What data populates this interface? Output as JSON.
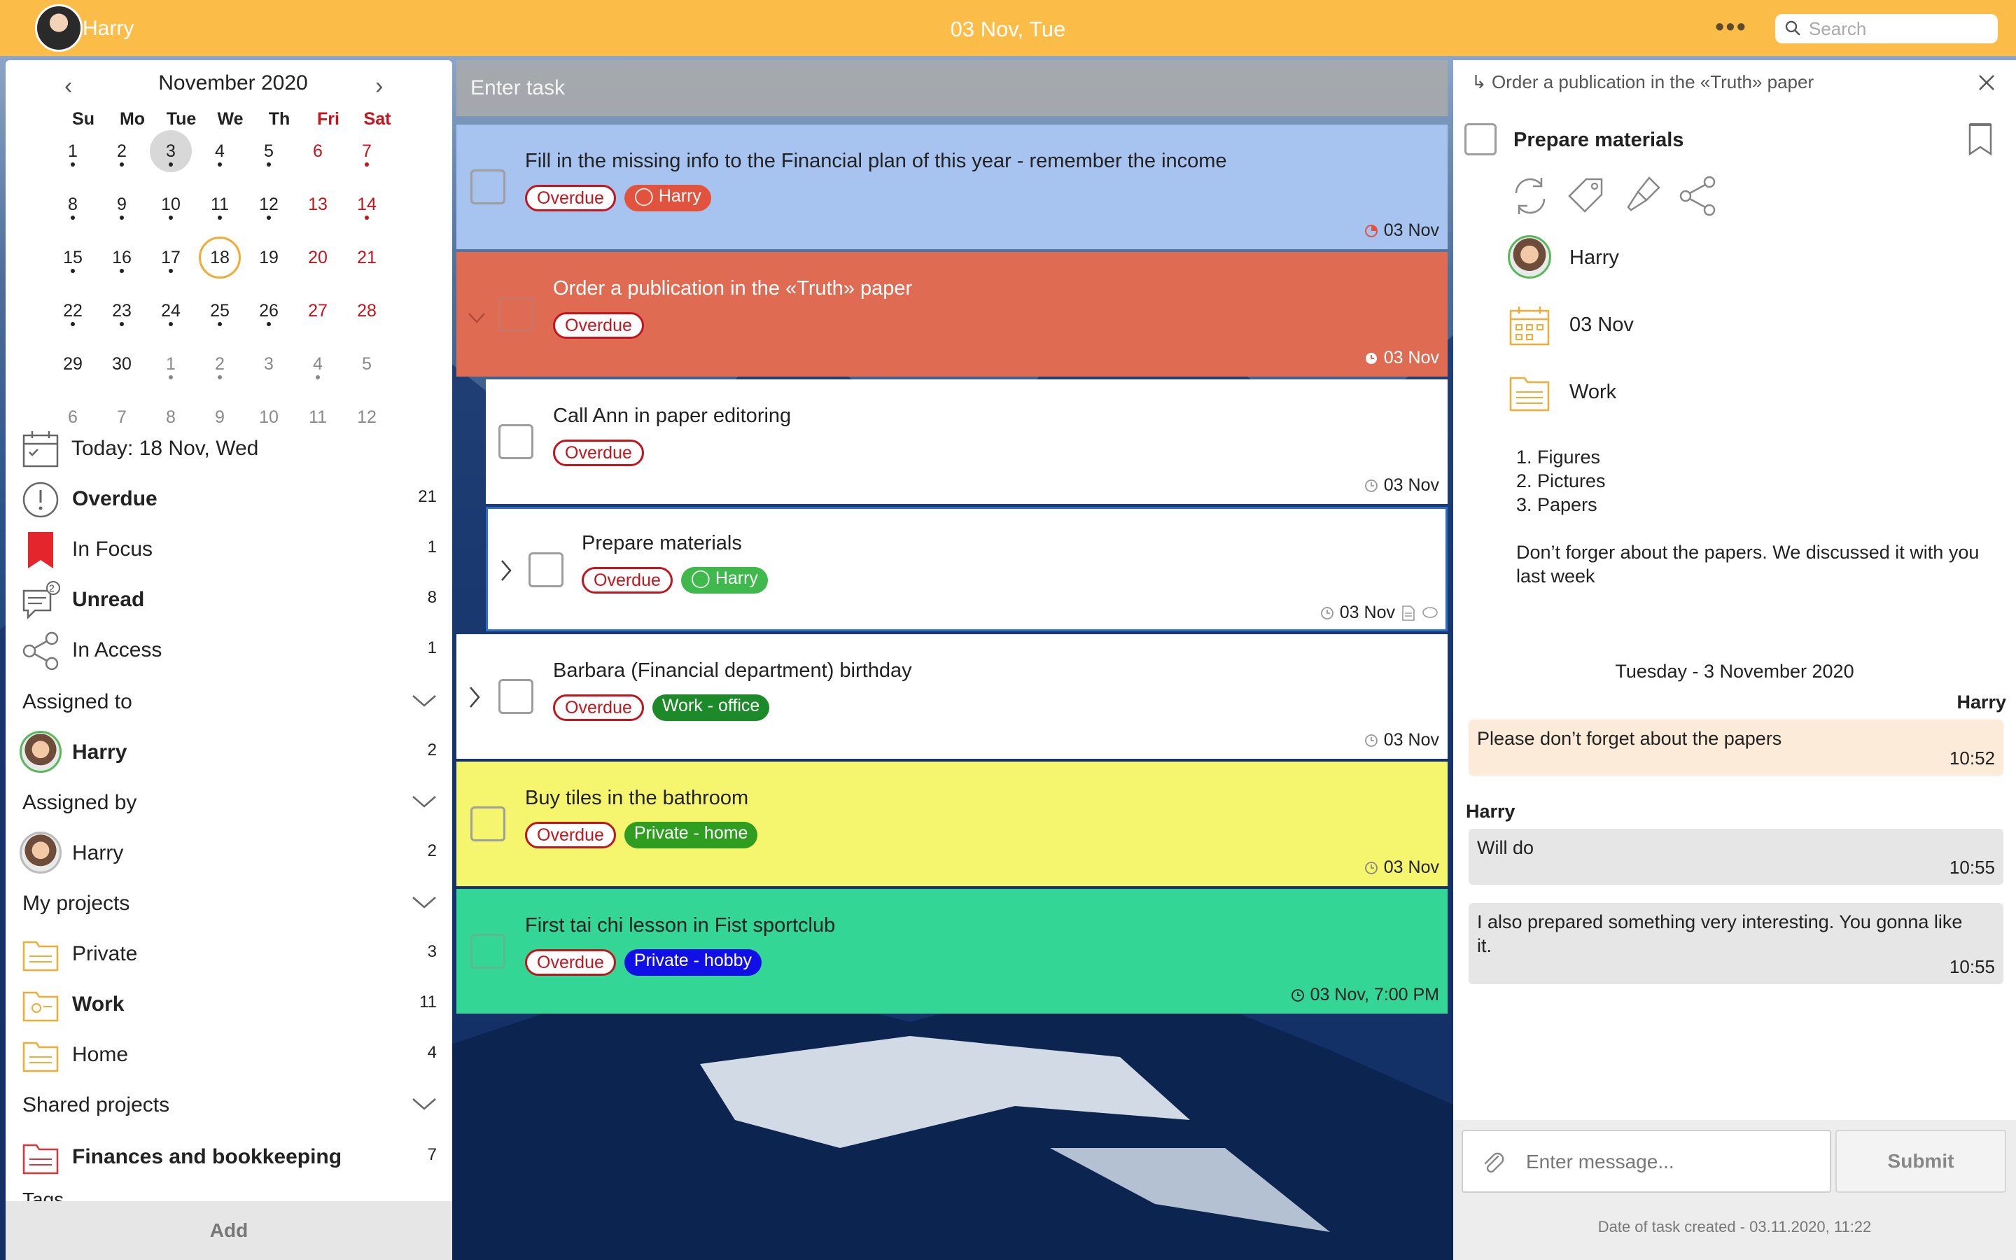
{
  "topbar": {
    "user_name": "Harry",
    "date_title": "03 Nov, Tue",
    "more_label": "•••",
    "search_placeholder": "Search"
  },
  "calendar": {
    "title": "November 2020",
    "prev_label": "‹",
    "next_label": "›",
    "weekdays": [
      "Su",
      "Mo",
      "Tue",
      "We",
      "Th",
      "Fri",
      "Sat"
    ],
    "weeks": [
      [
        "1",
        "2",
        "3",
        "4",
        "5",
        "6",
        "7"
      ],
      [
        "8",
        "9",
        "10",
        "11",
        "12",
        "13",
        "14"
      ],
      [
        "15",
        "16",
        "17",
        "18",
        "19",
        "20",
        "21"
      ],
      [
        "22",
        "23",
        "24",
        "25",
        "26",
        "27",
        "28"
      ],
      [
        "29",
        "30",
        "1",
        "2",
        "3",
        "4",
        "5"
      ],
      [
        "6",
        "7",
        "8",
        "9",
        "10",
        "11",
        "12"
      ]
    ],
    "selected_day": "3",
    "today_day": "18"
  },
  "left_nav": {
    "today": "Today: 18 Nov, Wed",
    "overdue": {
      "label": "Overdue",
      "count": "21"
    },
    "in_focus": {
      "label": "In Focus",
      "count": "1"
    },
    "unread": {
      "label": "Unread",
      "count": "8"
    },
    "in_access": {
      "label": "In Access",
      "count": "1"
    },
    "unread_badge": "2",
    "assigned_to": {
      "label": "Assigned to",
      "person": "Harry",
      "count": "2"
    },
    "assigned_by": {
      "label": "Assigned by",
      "person": "Harry",
      "count": "2"
    },
    "my_projects": {
      "label": "My projects",
      "items": [
        {
          "label": "Private",
          "count": "3"
        },
        {
          "label": "Work",
          "count": "11"
        },
        {
          "label": "Home",
          "count": "4"
        }
      ]
    },
    "shared_projects": {
      "label": "Shared projects",
      "items": [
        {
          "label": "Finances and bookkeeping",
          "count": "7"
        }
      ]
    },
    "scroll_tail": "Tags",
    "add_label": "Add"
  },
  "task_input": {
    "placeholder": "Enter task"
  },
  "tasks": [
    {
      "title": "Fill in the missing info to the Financial plan of this year - remember the income",
      "tags": [
        "Overdue",
        "Harry"
      ],
      "due": "03 Nov",
      "color": "#a7c3f0"
    },
    {
      "title": "Order a publication in the «Truth» paper",
      "tags": [
        "Overdue"
      ],
      "due": "03 Nov",
      "color": "#e06b53"
    },
    {
      "title": "Call Ann in paper editoring",
      "tags": [
        "Overdue"
      ],
      "due": "03 Nov",
      "color": "#ffffff"
    },
    {
      "title": "Prepare materials",
      "tags": [
        "Overdue",
        "Harry"
      ],
      "due": "03 Nov",
      "color": "#ffffff"
    },
    {
      "title": "Barbara (Financial department) birthday",
      "tags": [
        "Overdue",
        "Work - office"
      ],
      "due": "03 Nov",
      "color": "#ffffff"
    },
    {
      "title": "Buy tiles in the bathroom",
      "tags": [
        "Overdue",
        "Private - home"
      ],
      "due": "03 Nov",
      "color": "#f6f56e"
    },
    {
      "title": "First tai chi lesson in Fist sportclub",
      "tags": [
        "Overdue",
        "Private - hobby"
      ],
      "due": "03 Nov, 7:00 PM",
      "color": "#33d695"
    }
  ],
  "detail": {
    "parent": "Order a publication in the «Truth» paper",
    "title": "Prepare materials",
    "assignee": "Harry",
    "date": "03 Nov",
    "project": "Work",
    "checklist": [
      "1. Figures",
      "2. Pictures",
      "3. Papers"
    ],
    "note": "Don’t forger about the papers. We discussed it with you last week",
    "chat_date": "Tuesday - 3 November 2020",
    "messages": [
      {
        "sender": "Harry",
        "text": "Please don’t forget about the papers",
        "time": "10:52"
      },
      {
        "sender": "Harry",
        "text": "Will do",
        "time": "10:55"
      },
      {
        "sender": "",
        "text": "I also prepared something very interesting. You gonna like it.",
        "time": "10:55"
      }
    ],
    "message_placeholder": "Enter message...",
    "submit_label": "Submit",
    "created": "Date of task created - 03.11.2020, 11:22"
  },
  "colors": {
    "topbar": "#fcbd48",
    "overdue_red": "#c4151c",
    "accent_orange": "#f0ac36"
  }
}
